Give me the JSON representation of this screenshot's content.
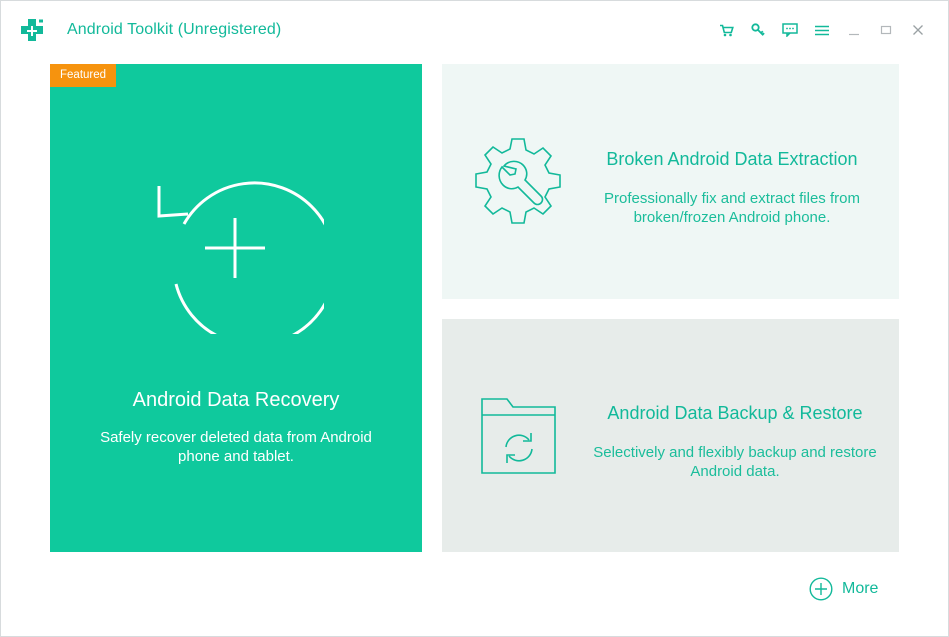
{
  "window": {
    "title": "Android Toolkit (Unregistered)",
    "logo_icon": "medical-cross-logo",
    "controls": [
      "cart-icon",
      "key-icon",
      "feedback-icon",
      "menu-icon",
      "minimize-icon",
      "maximize-icon",
      "close-icon"
    ]
  },
  "recovery": {
    "badge": "Featured",
    "title": "Android Data Recovery",
    "description": "Safely recover deleted data from Android phone and tablet.",
    "icon": "restore-plus-icon",
    "color": "#0fc99d",
    "badge_color": "#f6930e"
  },
  "extraction": {
    "title": "Broken Android Data Extraction",
    "description": "Professionally fix and extract files from broken/frozen Android phone.",
    "icon": "gear-wrench-icon"
  },
  "backup": {
    "title": "Android Data Backup & Restore",
    "description": "Selectively and flexibly backup and restore Android data.",
    "icon": "folder-sync-icon"
  },
  "more": {
    "label": "More",
    "icon": "plus-circle-icon"
  },
  "accent_color": "#12b99a"
}
